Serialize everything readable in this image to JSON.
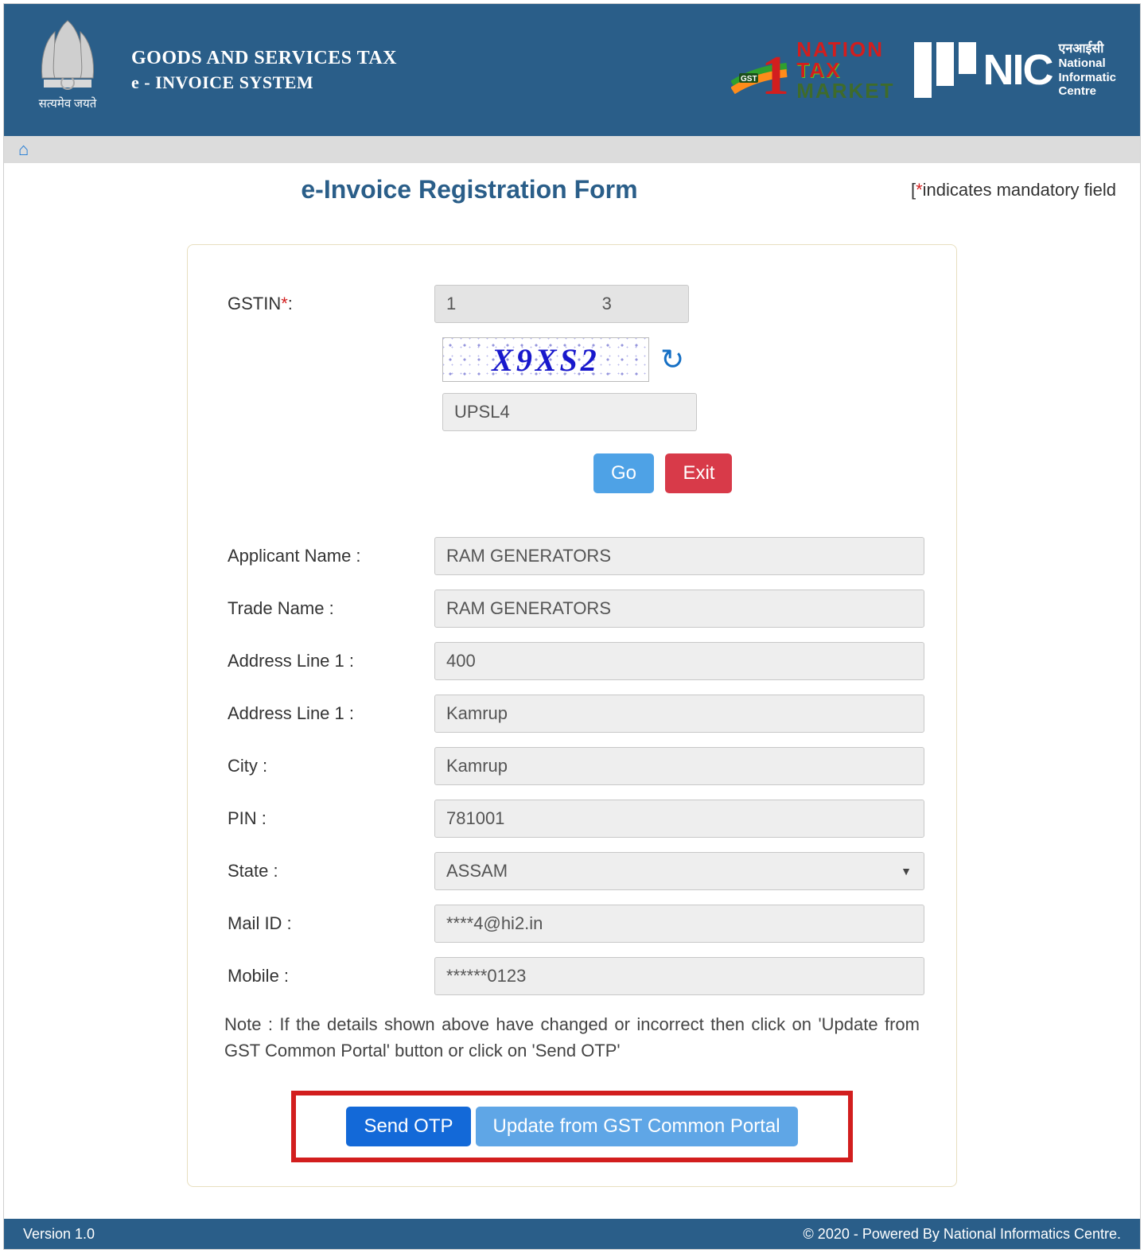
{
  "header": {
    "emblem_caption": "सत्यमेव जयते",
    "title_line1": "GOODS AND SERVICES TAX",
    "title_line2": "e - INVOICE SYSTEM",
    "ntm": {
      "nation": "NATION",
      "tax": "TAX",
      "market": "MARKET"
    },
    "nic": {
      "hindi": "एनआईसी",
      "en1": "National",
      "en2": "Informatic",
      "en3": "Centre",
      "big": "NIC"
    }
  },
  "nav": {
    "home_glyph": "⌂"
  },
  "page": {
    "title": "e-Invoice Registration Form",
    "mandatory_prefix": "[",
    "mandatory_star": "*",
    "mandatory_text": "indicates mandatory field"
  },
  "form": {
    "gstin_label": "GSTIN",
    "gstin_value": "1                              3",
    "captcha_text": "X9XS2",
    "captcha_input_value": "UPSL4",
    "go_label": "Go",
    "exit_label": "Exit",
    "rows": {
      "applicant": {
        "label": "Applicant Name :",
        "value": "RAM GENERATORS"
      },
      "trade": {
        "label": "Trade Name :",
        "value": "RAM GENERATORS"
      },
      "addr1": {
        "label": "Address Line 1 :",
        "value": "400"
      },
      "addr2": {
        "label": "Address Line 1 :",
        "value": "Kamrup"
      },
      "city": {
        "label": "City :",
        "value": "Kamrup"
      },
      "pin": {
        "label": "PIN :",
        "value": "781001"
      },
      "state": {
        "label": "State :",
        "value": "ASSAM"
      },
      "mail": {
        "label": "Mail ID :",
        "value": "****4@hi2.in"
      },
      "mobile": {
        "label": "Mobile :",
        "value": "******0123"
      }
    },
    "note": "Note : If the details shown above have changed or incorrect then click on 'Update from GST Common Portal' button or click on 'Send OTP'",
    "send_otp_label": "Send OTP",
    "update_label": "Update from GST Common Portal"
  },
  "footer": {
    "version": "Version 1.0",
    "copyright": "© 2020 - Powered By National Informatics Centre."
  }
}
